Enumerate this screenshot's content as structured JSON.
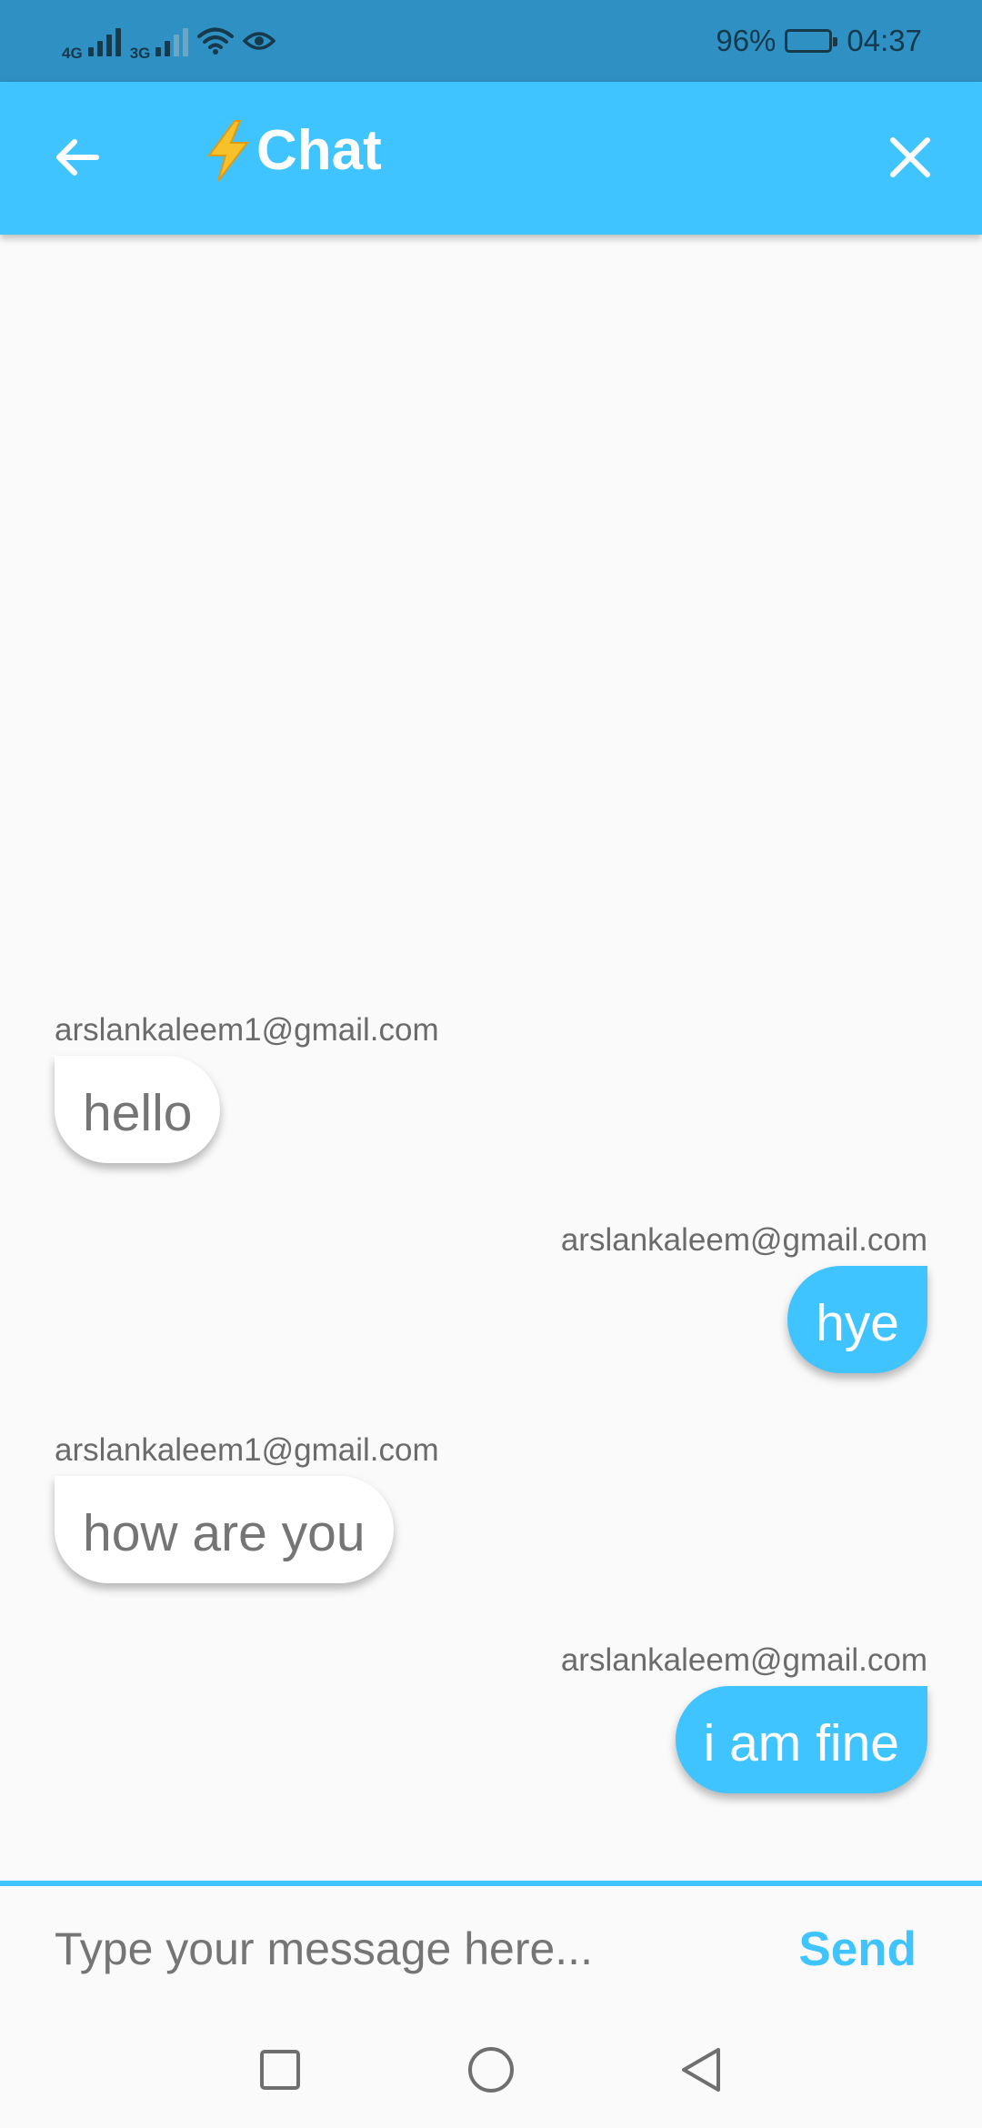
{
  "status_bar": {
    "network_1": "4G",
    "network_2": "3G",
    "battery": "96%",
    "time": "04:37",
    "icons": [
      "signal-icon",
      "signal-weak-icon",
      "wifi-icon",
      "eye-icon",
      "battery-icon"
    ]
  },
  "app_bar": {
    "title_emoji": "⚡",
    "title": "Chat",
    "back_icon": "arrow-left-icon",
    "close_icon": "close-icon",
    "color": "#40c4ff"
  },
  "messages": [
    {
      "sender": "arslankaleem1@gmail.com",
      "text": "hello",
      "side": "left"
    },
    {
      "sender": "arslankaleem@gmail.com",
      "text": "hye",
      "side": "right"
    },
    {
      "sender": "arslankaleem1@gmail.com",
      "text": "how are you",
      "side": "left"
    },
    {
      "sender": "arslankaleem@gmail.com",
      "text": "i am fine",
      "side": "right"
    }
  ],
  "composer": {
    "placeholder": "Type your message here...",
    "value": "",
    "send_label": "Send"
  },
  "nav": {
    "icons": [
      "recent-apps-icon",
      "home-icon",
      "back-triangle-icon"
    ]
  },
  "colors": {
    "accent": "#40c4ff",
    "status_bar": "#2f90c3",
    "incoming_bubble": "#ffffff",
    "outgoing_bubble": "#40c4ff"
  }
}
